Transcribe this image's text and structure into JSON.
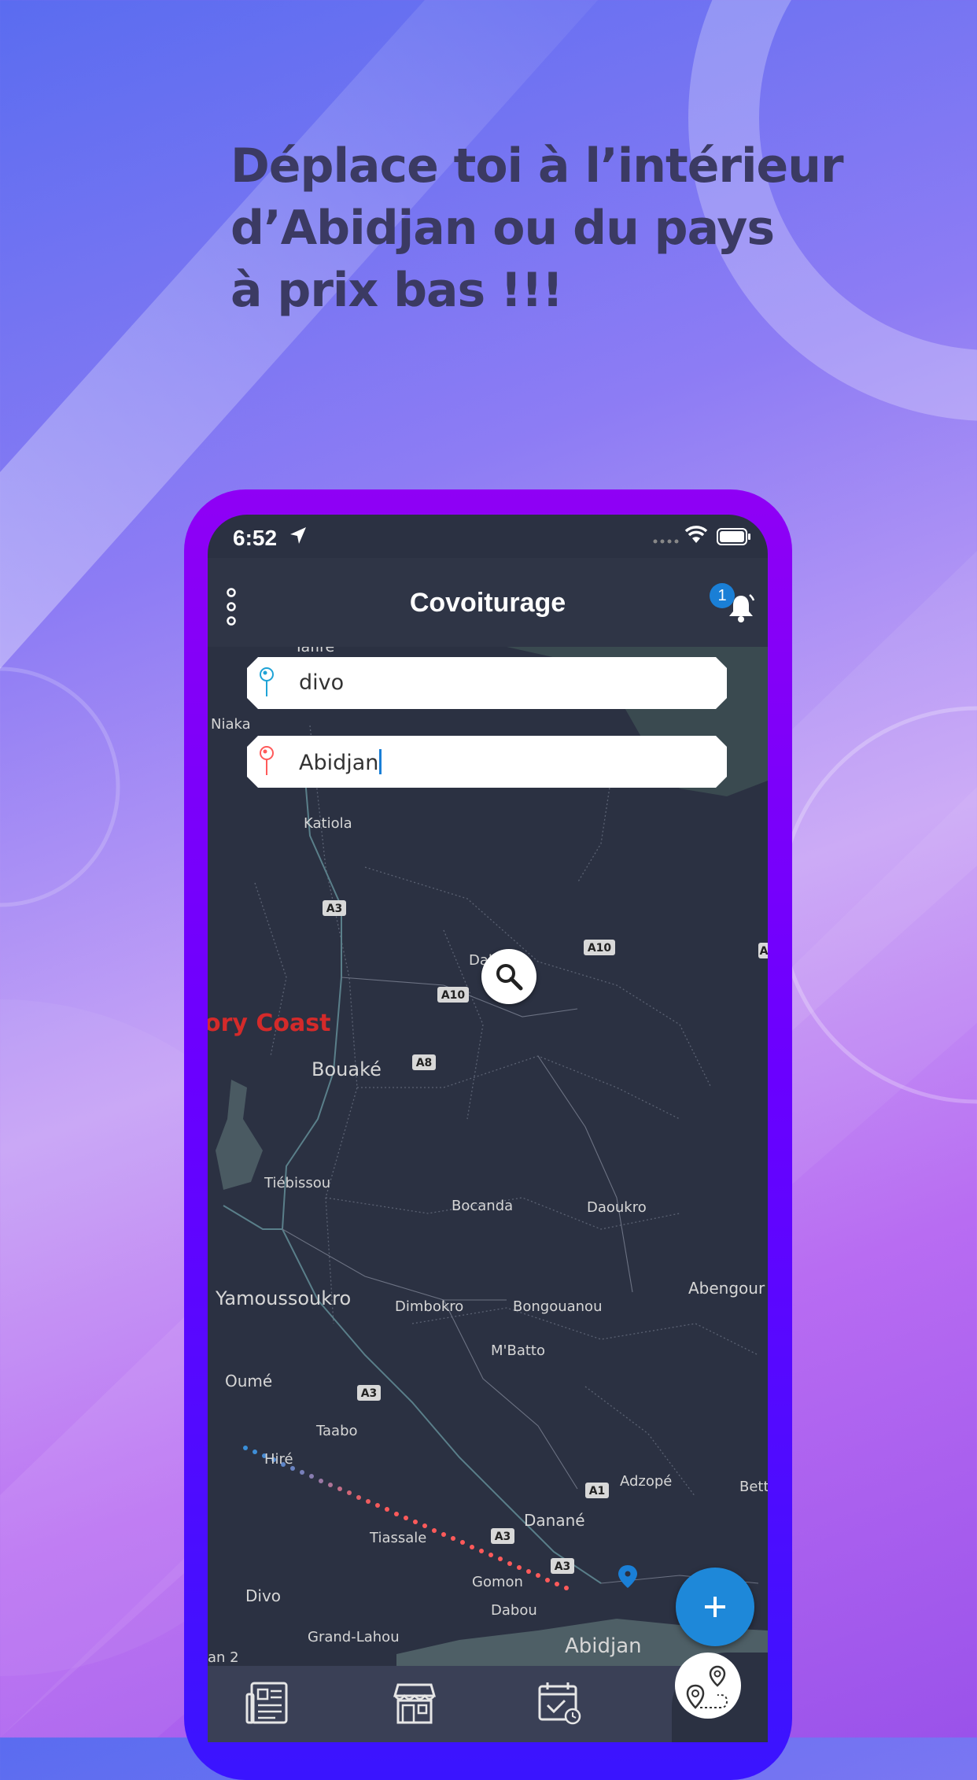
{
  "promo": {
    "line1": "Déplace toi à l’intérieur",
    "line2": "d’Abidjan ou du pays",
    "line3": "à prix bas !!!"
  },
  "status_bar": {
    "time": "6:52"
  },
  "app_bar": {
    "title": "Covoiturage",
    "notification_count": "1"
  },
  "search": {
    "from_value": "divo",
    "to_value": "Abidjan"
  },
  "map": {
    "country_label": "ory Coast",
    "cities": [
      "Niaka",
      "Katiola",
      "Bouaké",
      "Tiébissou",
      "Bocanda",
      "Daoukro",
      "Yamoussoukro",
      "Dimbokro",
      "Bongouanou",
      "Abengour",
      "M'Batto",
      "Oumé",
      "Taabo",
      "Hiré",
      "Adzopé",
      "Bett",
      "Danané",
      "Tiassale",
      "Divo",
      "Gomon",
      "Dabou",
      "Grand-Lahou",
      "Abidjan",
      "Dab",
      "an 2",
      "Tafire"
    ],
    "road_shields": [
      "A3",
      "A10",
      "A10",
      "A8",
      "A3",
      "A3",
      "A3",
      "A1",
      "A"
    ]
  },
  "bottom_nav": {
    "tabs": [
      "news-icon",
      "store-icon",
      "calendar-icon"
    ]
  },
  "colors": {
    "accent": "#1e88d9",
    "map_bg": "#2b3142",
    "route_start": "#3a8fd9",
    "route_end": "#ff5a5a"
  }
}
